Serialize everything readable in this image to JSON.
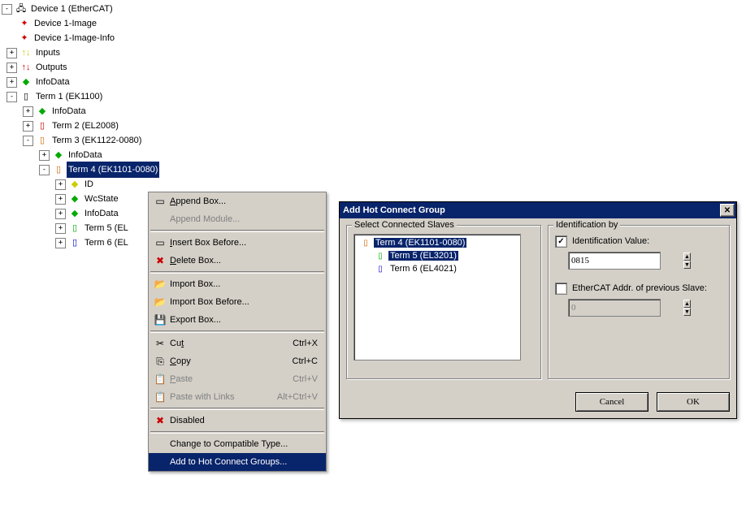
{
  "tree": {
    "device": "Device 1 (EtherCAT)",
    "image": "Device 1-Image",
    "imageInfo": "Device 1-Image-Info",
    "inputs": "Inputs",
    "outputs": "Outputs",
    "infoData": "InfoData",
    "term1": "Term 1 (EK1100)",
    "term1_info": "InfoData",
    "term2": "Term 2 (EL2008)",
    "term3": "Term 3 (EK1122-0080)",
    "term3_info": "InfoData",
    "term4": "Term 4 (EK1101-0080)",
    "term4_id": "ID",
    "term4_wc": "WcState",
    "term4_info": "InfoData",
    "term5": "Term 5 (EL",
    "term6": "Term 6 (EL"
  },
  "menu": {
    "appendBox": "Append Box...",
    "appendModule": "Append Module...",
    "insertBefore": "Insert Box Before...",
    "deleteBox": "Delete Box...",
    "importBox": "Import Box...",
    "importBoxBefore": "Import Box Before...",
    "exportBox": "Export Box...",
    "cut": "Cut",
    "copy": "Copy",
    "paste": "Paste",
    "pasteLinks": "Paste with Links",
    "cutKey": "Ctrl+X",
    "copyKey": "Ctrl+C",
    "pasteKey": "Ctrl+V",
    "pasteLinksKey": "Alt+Ctrl+V",
    "disabled": "Disabled",
    "changeType": "Change to Compatible Type...",
    "addHot": "Add to Hot Connect Groups..."
  },
  "dialog": {
    "title": "Add Hot Connect Group",
    "groupSlaves": "Select Connected Slaves",
    "groupIdent": "Identification by",
    "chkIdentVal": "Identification Value:",
    "identVal": "0815",
    "chkAddr": "EtherCAT Addr. of previous Slave:",
    "addrVal": "0",
    "cancel": "Cancel",
    "ok": "OK",
    "slaves": {
      "t4": "Term 4 (EK1101-0080)",
      "t5": "Term 5 (EL3201)",
      "t6": "Term 6 (EL4021)"
    }
  }
}
